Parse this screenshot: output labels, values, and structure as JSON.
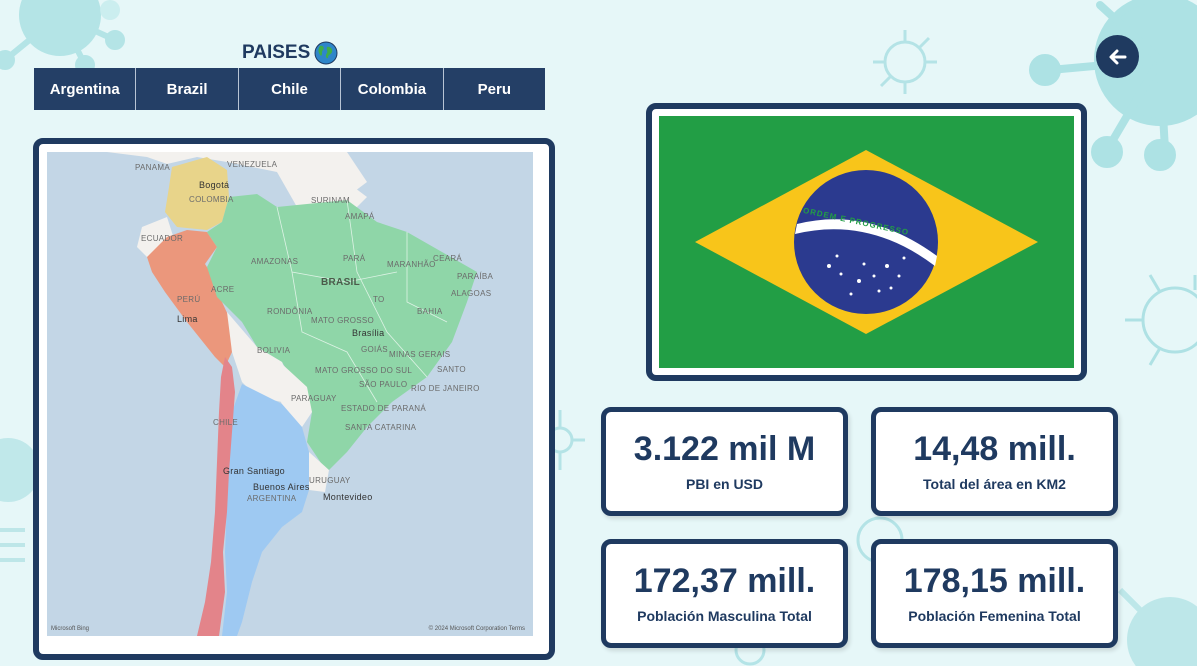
{
  "header": {
    "title": "PAISES",
    "globe_icon": "globe-icon"
  },
  "tabs": [
    {
      "label": "Argentina"
    },
    {
      "label": "Brazil"
    },
    {
      "label": "Chile"
    },
    {
      "label": "Colombia"
    },
    {
      "label": "Peru"
    }
  ],
  "back_button": {
    "icon": "arrow-left-icon"
  },
  "map": {
    "labels": {
      "venezuela": "VENEZUELA",
      "panama": "PANAMA",
      "colombia": "COLOMBIA",
      "bogota": "Bogotá",
      "suriname": "SURINAM",
      "ecuador": "ECUADOR",
      "amapa": "AMAPÁ",
      "amazonas": "AMAZONAS",
      "para": "PARÁ",
      "maranhao": "MARANHÃO",
      "ceara": "CEARÁ",
      "paraiba": "PARAÍBA",
      "alagoas": "ALAGOAS",
      "brasil": "BRASIL",
      "acre": "ACRE",
      "peru": "PERÚ",
      "lima": "Lima",
      "rondonia": "RONDÔNIA",
      "mato_grosso": "MATO GROSSO",
      "to": "TO",
      "bahia": "BAHIA",
      "brasilia": "Brasília",
      "goias": "GOIÁS",
      "minas": "MINAS GERAIS",
      "bolivia": "BOLIVIA",
      "mato_grosso_sul": "MATO GROSSO DO SUL",
      "santo": "SANTO",
      "sao_paulo": "SÃO PAULO",
      "rio": "RIO DE JANEIRO",
      "paraguay": "PARAGUAY",
      "parana": "ESTADO DE PARANÁ",
      "santa_catarina": "SANTA CATARINA",
      "chile": "CHILE",
      "gran_santiago": "Gran Santiago",
      "buenos_aires": "Buenos Aires",
      "argentina": "ARGENTINA",
      "uruguay": "URUGUAY",
      "montevideo": "Montevideo"
    },
    "attribution_left": "Microsoft Bing",
    "attribution_right": "© 2024 Microsoft Corporation  Terms",
    "colors": {
      "ocean": "#c3d6e6",
      "brazil": "#8fd6a8",
      "colombia": "#e8d48a",
      "peru": "#eb977c",
      "chile": "#e3848a",
      "argentina": "#9ec9f2",
      "other_land": "#f3f1ee"
    }
  },
  "flag": {
    "motto": "ORDEM E PROGRESSO",
    "colors": {
      "green": "#229e45",
      "yellow": "#f8c51a",
      "blue": "#2b3a8f",
      "white": "#ffffff"
    }
  },
  "kpis": [
    {
      "value": "3.122 mil M",
      "label": "PBI en USD"
    },
    {
      "value": "14,48 mill.",
      "label": "Total del área en KM2"
    },
    {
      "value": "172,37 mill.",
      "label": "Población Masculina Total"
    },
    {
      "value": "178,15 mill.",
      "label": "Población Femenina Total"
    }
  ],
  "theme": {
    "navy": "#1f3a60",
    "background": "#e6f7f8",
    "virus": "#9fdde0"
  }
}
